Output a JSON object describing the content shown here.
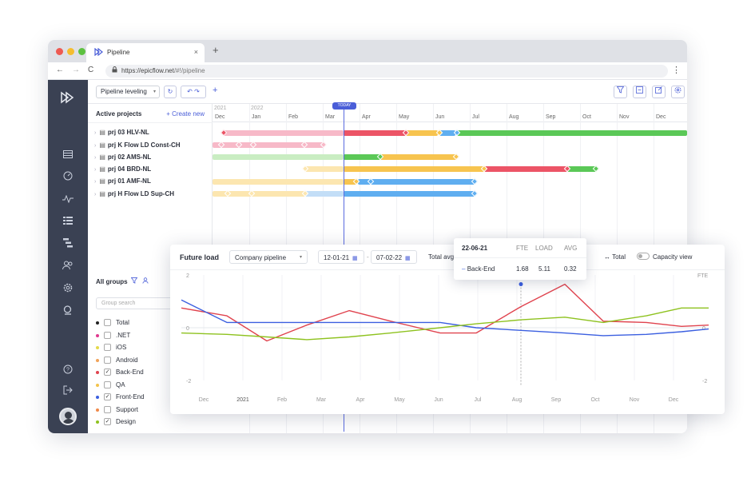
{
  "browser": {
    "tab_title": "Pipeline",
    "tab_close": "×",
    "new_tab": "+",
    "url_host": "https://epicflow.net",
    "url_path": "/#!/pipeline",
    "back": "←",
    "forward": "→",
    "reload": "C",
    "menu": "⋮"
  },
  "toolbar": {
    "mode_label": "Pipeline leveling",
    "add": "+"
  },
  "projects_panel": {
    "title": "Active projects",
    "create_label": "+ Create new",
    "projects": [
      "prj 03 HLV-NL",
      "prj K Flow LD Const-CH",
      "prj 02 AMS-NL",
      "prj 04 BRD-NL",
      "prj 01 AMF-NL",
      "prj H Flow LD Sup-CH"
    ]
  },
  "timeline": {
    "years": [
      "2021",
      "2022"
    ],
    "months": [
      "Dec",
      "Jan",
      "Feb",
      "Mar",
      "Apr",
      "May",
      "Jun",
      "Jul",
      "Aug",
      "Sep",
      "Oct",
      "Nov",
      "Dec"
    ],
    "today_label": "TODAY"
  },
  "groups_panel": {
    "title": "All groups",
    "search_placeholder": "Group search",
    "groups": [
      {
        "name": "Total",
        "checked": false,
        "color": "#222222"
      },
      {
        "name": ".NET",
        "checked": false,
        "color": "#e0398f"
      },
      {
        "name": "iOS",
        "checked": false,
        "color": "#e4d94a"
      },
      {
        "name": "Android",
        "checked": false,
        "color": "#f0a35a"
      },
      {
        "name": "Back-End",
        "checked": true,
        "color": "#e0434e"
      },
      {
        "name": "QA",
        "checked": false,
        "color": "#f3c34b"
      },
      {
        "name": "Front-End",
        "checked": true,
        "color": "#3b5fe0"
      },
      {
        "name": "Support",
        "checked": false,
        "color": "#f0894a"
      },
      {
        "name": "Design",
        "checked": true,
        "color": "#8ec21f"
      }
    ]
  },
  "future_load": {
    "title": "Future load",
    "pipeline_select": "Company pipeline",
    "date_from": "12-01-21",
    "date_to": "07-02-22",
    "date_sep": "-",
    "total_avg_label": "Total avg",
    "total_label": "Total",
    "total_icon": "↔",
    "capacity_label": "Capacity view"
  },
  "tooltip": {
    "date": "22-06-21",
    "headers": [
      "FTE",
      "LOAD",
      "AVG"
    ],
    "row": {
      "name": "Back-End",
      "fte": "1.68",
      "load": "5.11",
      "avg": "0.32"
    }
  },
  "chart_data": {
    "type": "line",
    "ylabel": "FTE",
    "ylim": [
      -2,
      2
    ],
    "yticks_left": [
      "2",
      "0",
      "-2"
    ],
    "yticks_right": [
      "0",
      "-2"
    ],
    "x_labels": [
      "Dec",
      "2021",
      "Feb",
      "Mar",
      "Apr",
      "May",
      "Jun",
      "Jul",
      "Aug",
      "Sep",
      "Oct",
      "Nov",
      "Dec"
    ],
    "series": [
      {
        "name": "Back-End",
        "color": "#e0434e",
        "values": [
          0.75,
          0.45,
          -0.5,
          0.1,
          0.65,
          0.25,
          -0.2,
          -0.2,
          0.8,
          1.65,
          0.25,
          0.2,
          0.05,
          0.1
        ]
      },
      {
        "name": "Front-End",
        "color": "#3b5fe0",
        "values": [
          1.05,
          0.2,
          0.2,
          0.2,
          0.2,
          0.2,
          0.2,
          0.0,
          -0.1,
          -0.2,
          -0.3,
          -0.25,
          -0.15,
          -0.05
        ]
      },
      {
        "name": "Design",
        "color": "#8ec21f",
        "values": [
          -0.2,
          -0.25,
          -0.35,
          -0.45,
          -0.35,
          -0.2,
          0.0,
          0.15,
          0.3,
          0.4,
          0.2,
          0.45,
          0.75,
          0.75
        ]
      }
    ],
    "highlight_index": 9
  }
}
